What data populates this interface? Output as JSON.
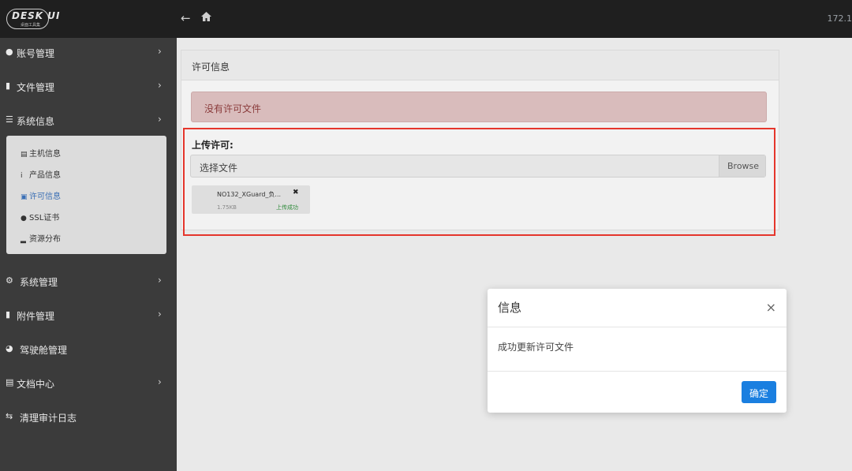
{
  "topbar": {
    "logo_text": "DESK UI",
    "logo_sub": "桌面工具集",
    "back_icon": "arrow-left-icon",
    "home_icon": "home-icon",
    "right_text": "172.1"
  },
  "sidebar": {
    "items": [
      {
        "label": "账号管理",
        "icon": "user-icon",
        "has_chevron": true
      },
      {
        "label": "文件管理",
        "icon": "file-icon",
        "has_chevron": true
      },
      {
        "label": "系统信息",
        "icon": "list-icon",
        "has_chevron": true
      },
      {
        "label": "系统管理",
        "icon": "gears-icon",
        "has_chevron": true
      },
      {
        "label": "附件管理",
        "icon": "file-icon",
        "has_chevron": true
      },
      {
        "label": "驾驶舱管理",
        "icon": "dashboard-icon",
        "has_chevron": false
      },
      {
        "label": "文档中心",
        "icon": "document-icon",
        "has_chevron": true
      },
      {
        "label": "清理审计日志",
        "icon": "exchange-icon",
        "has_chevron": false
      }
    ],
    "submenu": [
      {
        "label": "主机信息",
        "icon": "server-icon"
      },
      {
        "label": "产品信息",
        "icon": "info-icon"
      },
      {
        "label": "许可信息",
        "icon": "card-icon",
        "active": true
      },
      {
        "label": "SSL证书",
        "icon": "circle-icon"
      },
      {
        "label": "资源分布",
        "icon": "signal-icon"
      }
    ]
  },
  "panel": {
    "title": "许可信息",
    "alert": "没有许可文件",
    "upload_label": "上传许可:",
    "file_placeholder": "选择文件",
    "browse_label": "Browse",
    "file": {
      "name": "NO132_XGuard_负...",
      "size": "1.75KB",
      "status": "上传成功"
    }
  },
  "modal": {
    "title": "信息",
    "message": "成功更新许可文件",
    "ok_label": "确定",
    "close_glyph": "×"
  },
  "colors": {
    "sidebar_bg": "#3b3b3b",
    "topbar_bg": "#1f1f1f",
    "alert_bg": "#d9bcbc",
    "highlight_border": "#e5362c",
    "primary": "#1a7fe0",
    "active_link": "#3a6fb5",
    "success_text": "#2e8b3a"
  }
}
